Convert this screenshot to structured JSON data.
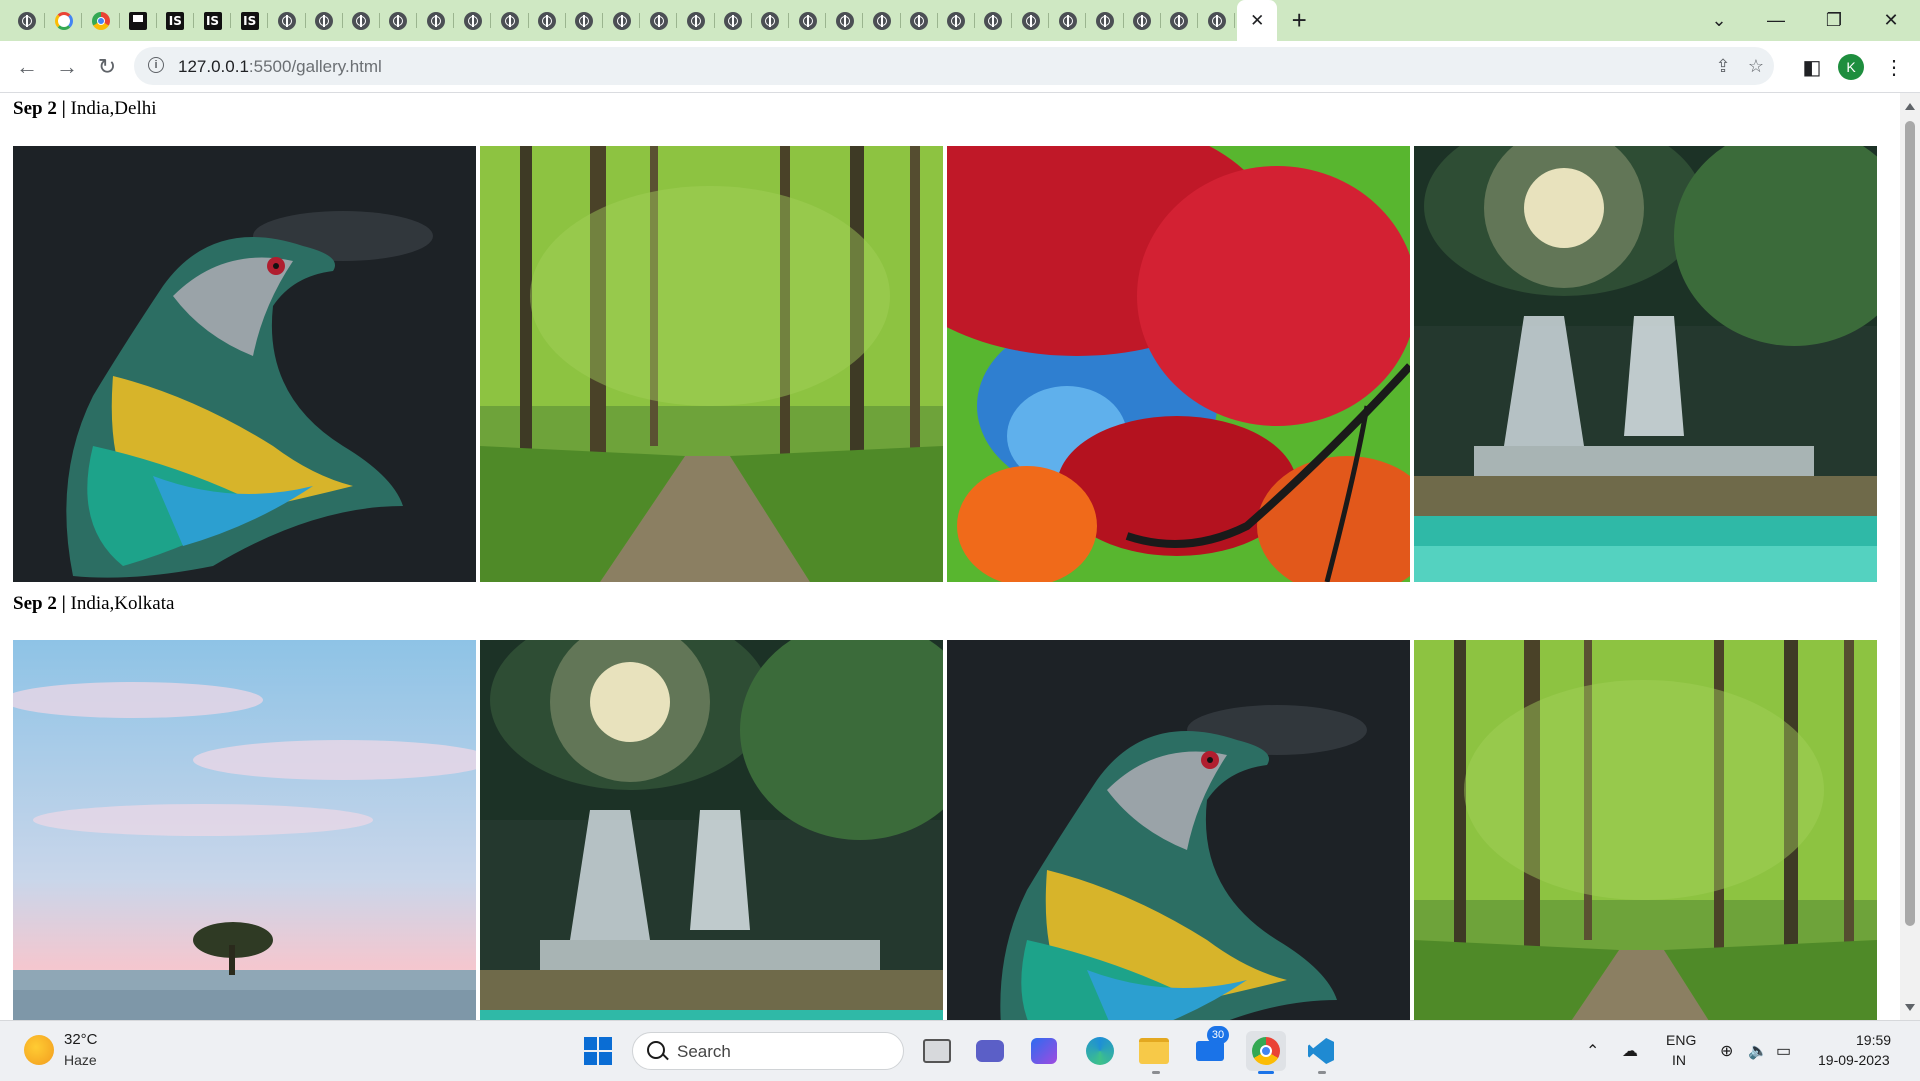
{
  "browser": {
    "address": {
      "host": "127.0.0.1",
      "path": ":5500/gallery.html"
    },
    "profile_initial": "K",
    "tab_close": "✕",
    "new_tab": "+"
  },
  "gallery": {
    "groups": [
      {
        "date": "Sep 2 |",
        "location": "India,Delhi",
        "photos": [
          "bird",
          "forest-path",
          "red-maple",
          "waterfall"
        ]
      },
      {
        "date": "Sep 2 |",
        "location": "India,Kolkata",
        "photos": [
          "sea-tree",
          "waterfall",
          "bird",
          "forest-path"
        ]
      }
    ]
  },
  "taskbar": {
    "weather": {
      "temp": "32°C",
      "condition": "Haze"
    },
    "search_placeholder": "Search",
    "mail_badge": "30",
    "language": {
      "line1": "ENG",
      "line2": "IN"
    },
    "clock": {
      "time": "19:59",
      "date": "19-09-2023"
    }
  }
}
